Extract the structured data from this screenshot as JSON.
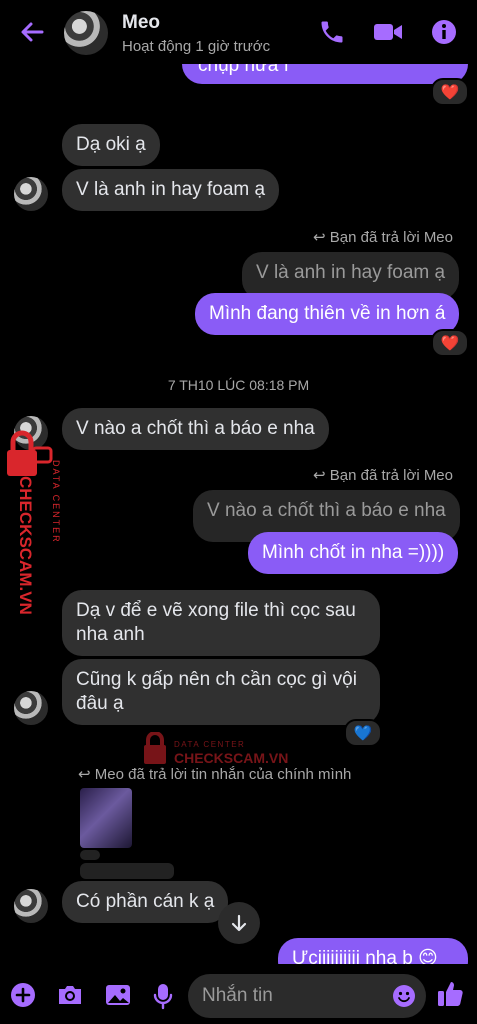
{
  "header": {
    "contact_name": "Meo",
    "status": "Hoạt động 1 giờ trước"
  },
  "messages": {
    "partial_out": "chụp nữa í",
    "m1": "Dạ oki ạ",
    "m2": "V là anh in hay foam ạ",
    "reply1_label": "Bạn đã trả lời Meo",
    "reply1_quote": "V là anh in hay foam ạ",
    "reply1_text": "Mình đang thiên về in hơn á",
    "timestamp": "7 TH10 LÚC 08:18 PM",
    "m3": "V nào a chốt thì a báo e nha",
    "reply2_label": "Bạn đã trả lời Meo",
    "reply2_quote": "V nào a chốt thì a báo e nha",
    "reply2_text": "Mình chốt in nha =))))",
    "m4": "Dạ v để e vẽ xong file thì cọc sau nha anh",
    "m5": "Cũng k gấp nên ch cần cọc gì vội đâu ạ",
    "reply3_label": "Meo đã trả lời tin nhắn của chính mình",
    "m6": "Có phần cán k ạ",
    "partial_out2": "Ưciiiiiiiiii nha b 😊"
  },
  "reactions": {
    "heart": "❤️",
    "blue_heart": "💙"
  },
  "input": {
    "placeholder": "Nhắn tin"
  },
  "watermark": {
    "line1": "DATA CENTER",
    "line2": "CHECKSCAM.VN"
  },
  "colors": {
    "accent": "#a66cff",
    "outgoing_bubble": "#8a5cf6",
    "incoming_bubble": "#303030",
    "background": "#000000"
  }
}
